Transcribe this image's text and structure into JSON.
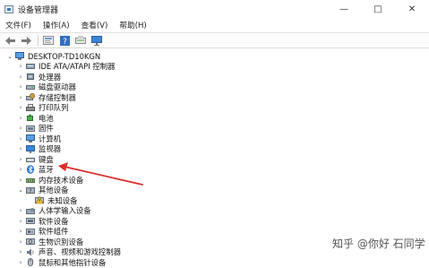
{
  "window": {
    "title": "设备管理器",
    "controls": [
      "—",
      "□",
      "✕"
    ]
  },
  "menu": [
    "文件(F)",
    "操作(A)",
    "查看(V)",
    "帮助(H)"
  ],
  "toolbar": [
    "back-icon",
    "forward-icon",
    "properties-icon",
    "help-icon",
    "scan-icon",
    "monitor-icon"
  ],
  "tree": {
    "root": "DESKTOP-TD10KGN",
    "items": [
      {
        "label": "IDE ATA/ATAPI 控制器",
        "icon": "ide-icon",
        "expanded": false
      },
      {
        "label": "处理器",
        "icon": "processor-icon",
        "expanded": false
      },
      {
        "label": "磁盘驱动器",
        "icon": "disk-icon",
        "expanded": false
      },
      {
        "label": "存储控制器",
        "icon": "storage-icon",
        "expanded": false
      },
      {
        "label": "打印队列",
        "icon": "printer-icon",
        "expanded": false
      },
      {
        "label": "电池",
        "icon": "battery-icon",
        "expanded": false
      },
      {
        "label": "固件",
        "icon": "firmware-icon",
        "expanded": false
      },
      {
        "label": "计算机",
        "icon": "computer-icon",
        "expanded": false
      },
      {
        "label": "监视器",
        "icon": "monitor-icon",
        "expanded": false
      },
      {
        "label": "键盘",
        "icon": "keyboard-icon",
        "expanded": false
      },
      {
        "label": "蓝牙",
        "icon": "bluetooth-icon",
        "expanded": false
      },
      {
        "label": "内存技术设备",
        "icon": "memory-icon",
        "expanded": false
      },
      {
        "label": "其他设备",
        "icon": "other-devices-icon",
        "expanded": true
      },
      {
        "label": "未知设备",
        "icon": "unknown-device-icon",
        "child": true
      },
      {
        "label": "人体学输入设备",
        "icon": "hid-icon",
        "expanded": false
      },
      {
        "label": "软件设备",
        "icon": "software-device-icon",
        "expanded": false
      },
      {
        "label": "软件组件",
        "icon": "software-component-icon",
        "expanded": false
      },
      {
        "label": "生物识别设备",
        "icon": "biometric-icon",
        "expanded": false
      },
      {
        "label": "声音、视频和游戏控制器",
        "icon": "audio-icon",
        "expanded": false
      },
      {
        "label": "鼠标和其他指针设备",
        "icon": "mouse-icon",
        "expanded": false
      }
    ]
  },
  "annotation": {
    "color": "#d9302c"
  },
  "watermark": "知乎 @你好 石同学"
}
